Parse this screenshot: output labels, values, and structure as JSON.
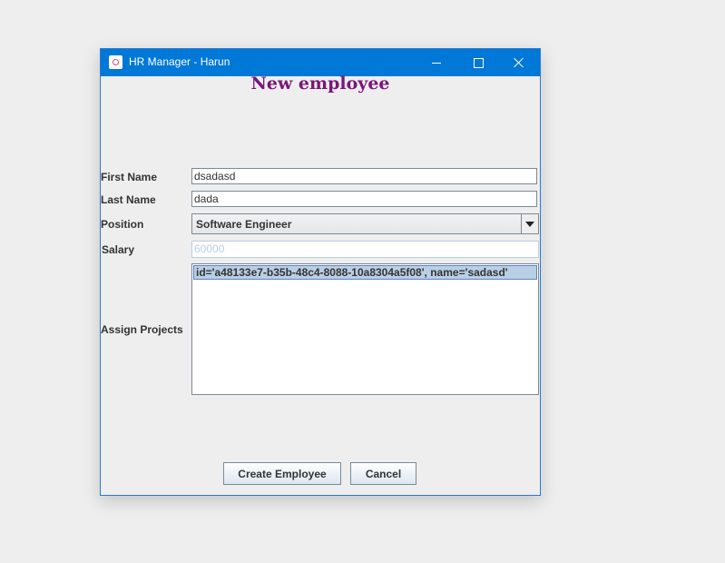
{
  "window": {
    "title": "HR Manager - Harun"
  },
  "form": {
    "heading": "New employee",
    "first_name": {
      "label": "First Name",
      "value": "dsadasd"
    },
    "last_name": {
      "label": "Last Name",
      "value": "dada"
    },
    "position": {
      "label": "Position",
      "selected": "Software Engineer"
    },
    "salary": {
      "label": "Salary",
      "value": "60000"
    },
    "projects": {
      "label": "Assign Projects",
      "items": [
        "id='a48133e7-b35b-48c4-8088-10a8304a5f08', name='sadasd'"
      ]
    }
  },
  "buttons": {
    "create": "Create Employee",
    "cancel": "Cancel"
  },
  "icons": {
    "app": "app-icon",
    "minimize": "minimize-icon",
    "maximize": "maximize-icon",
    "close": "close-icon",
    "dropdown": "chevron-down-icon"
  },
  "colors": {
    "titlebar": "#0078d7",
    "heading": "#7a167a",
    "selection": "#b8cfe5"
  }
}
